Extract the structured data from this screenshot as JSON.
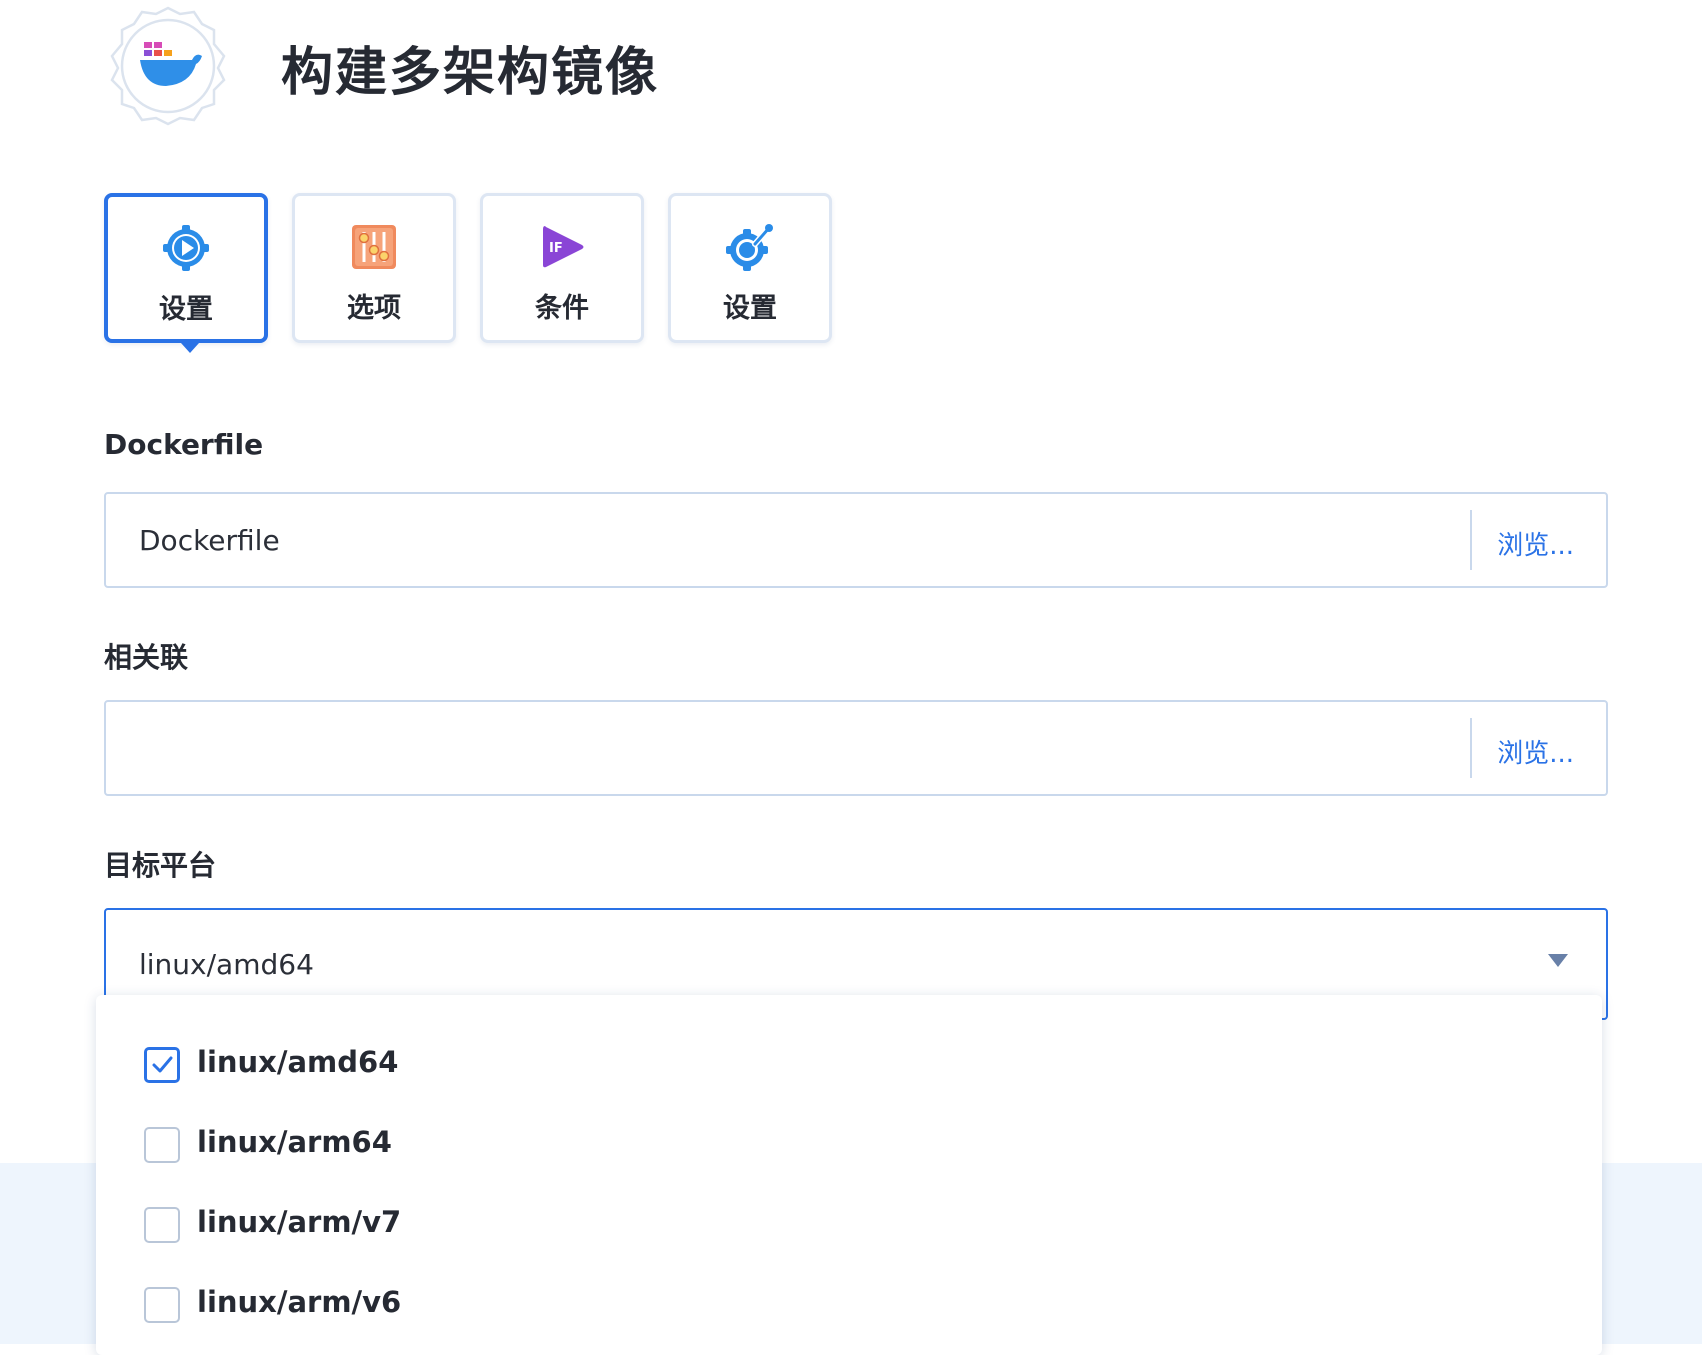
{
  "header": {
    "title": "构建多架构镜像",
    "logo_icon": "docker-whale-gear-icon"
  },
  "tabs": [
    {
      "label": "设置",
      "icon": "gear-play-icon",
      "active": true
    },
    {
      "label": "选项",
      "icon": "sliders-icon",
      "active": false
    },
    {
      "label": "条件",
      "icon": "if-play-icon",
      "active": false
    },
    {
      "label": "设置",
      "icon": "gear-wrench-icon",
      "active": false
    }
  ],
  "fields": {
    "dockerfile": {
      "label": "Dockerfile",
      "value": "Dockerfile",
      "browse_label": "浏览..."
    },
    "context": {
      "label": "相关联",
      "value": "",
      "browse_label": "浏览..."
    },
    "platform": {
      "label": "目标平台",
      "value": "linux/amd64"
    }
  },
  "platform_options": [
    {
      "label": "linux/amd64",
      "checked": true
    },
    {
      "label": "linux/arm64",
      "checked": false
    },
    {
      "label": "linux/arm/v7",
      "checked": false
    },
    {
      "label": "linux/arm/v6",
      "checked": false
    }
  ],
  "colors": {
    "accent": "#2a72e6",
    "border": "#c9d8ec",
    "footer": "#eef5fd"
  }
}
